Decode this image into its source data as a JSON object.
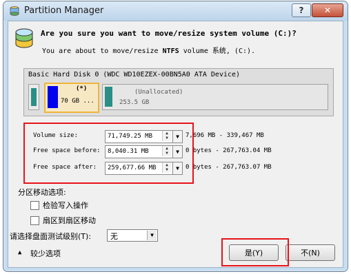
{
  "window": {
    "title": "Partition Manager",
    "help_glyph": "?",
    "close_glyph": "✕"
  },
  "dialog": {
    "question": "Are you sure you want to move/resize system volume (C:)?",
    "subtext_prefix": "You are about to move/resize",
    "subtext_fs": "NTFS",
    "subtext_suffix": "volume 系统, (C:).",
    "disk": {
      "header": "Basic Hard Disk 0 (WDC WD10EZEX-00BN5A0 ATA Device)",
      "partition_c_label": "(*)",
      "partition_c_size": "70 GB ...",
      "unallocated_label": "(Unallocated)",
      "unallocated_size": "253.5 GB"
    },
    "fields": {
      "volume_size": {
        "label": "Volume size:",
        "value": "71,749.25 MB",
        "range": "7,696 MB - 339,467 MB"
      },
      "free_before": {
        "label": "Free space before:",
        "value": "8,040.31 MB",
        "range": "0 bytes - 267,763.04 MB"
      },
      "free_after": {
        "label": "Free space after:",
        "value": "259,677.66 MB",
        "range": "0 bytes - 267,763.07 MB"
      }
    },
    "move_options": {
      "title": "分区移动选项:",
      "verify_write": "检验写入操作",
      "sector_move": "扇区到扇区移动",
      "verify_checked": false,
      "sector_checked": false
    },
    "test_level": {
      "label": "请选择盘面测试级别(T):",
      "value": "无"
    },
    "less_options": "较少选项",
    "yes_button": "是(Y)",
    "no_button": "不(N)"
  },
  "colors": {
    "highlight_red": "#e8121a",
    "partition_blue": "#0000ee",
    "partition_teal": "#2a8f86",
    "selected_border": "#f0b437"
  }
}
